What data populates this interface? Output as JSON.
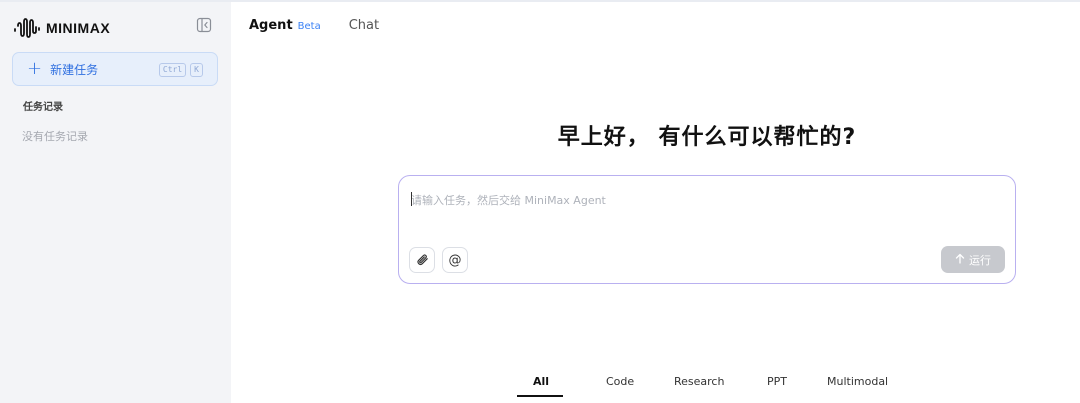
{
  "brand": {
    "name": "MINIMAX",
    "logo_icon": "waveform-icon"
  },
  "sidebar": {
    "collapse_icon": "sidebar-collapse-icon",
    "new_task": {
      "label": "新建任务",
      "shortcut": [
        "Ctrl",
        "K"
      ],
      "icon": "plus-icon"
    },
    "section_title": "任务记录",
    "empty_text": "没有任务记录"
  },
  "topnav": {
    "tabs": [
      {
        "label": "Agent",
        "badge": "Beta",
        "active": true
      },
      {
        "label": "Chat",
        "active": false
      }
    ]
  },
  "main": {
    "greeting": "早上好， 有什么可以帮忙的?",
    "composer": {
      "placeholder": "请输入任务，然后交给 MiniMax Agent",
      "value": "",
      "attach_icon": "paperclip-icon",
      "mention_icon": "at-sign-icon",
      "mention_glyph": "@",
      "run_label": "运行",
      "run_icon": "arrow-up-icon"
    },
    "filters": [
      "All",
      "Code",
      "Research",
      "PPT",
      "Multimodal"
    ],
    "active_filter": "All"
  },
  "colors": {
    "accent": "#2f6fe0",
    "beta": "#3b82f6",
    "composer_border": "#b9b0f0",
    "sidebar_bg": "#f3f4f7",
    "run_disabled": "#c7c9ce"
  }
}
